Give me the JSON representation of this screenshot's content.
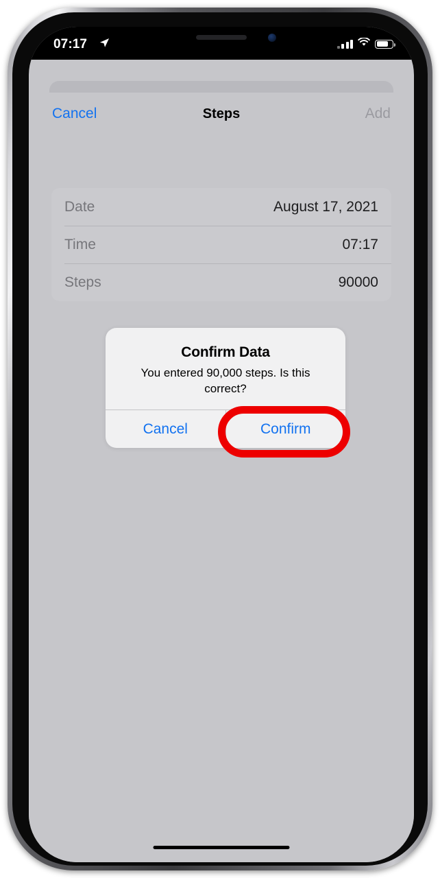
{
  "status_bar": {
    "time": "07:17",
    "location_icon": "location-arrow-icon",
    "signal_icon": "cellular-signal-icon",
    "wifi_icon": "wifi-icon",
    "battery_icon": "battery-icon",
    "signal_bars": 4,
    "battery_level_percent": 67
  },
  "nav_bar": {
    "cancel_label": "Cancel",
    "title": "Steps",
    "add_label": "Add"
  },
  "form": {
    "rows": [
      {
        "label": "Date",
        "value": "August 17, 2021"
      },
      {
        "label": "Time",
        "value": "07:17"
      },
      {
        "label": "Steps",
        "value": "90000"
      }
    ]
  },
  "alert": {
    "title": "Confirm Data",
    "message": "You entered 90,000 steps. Is this correct?",
    "cancel_label": "Cancel",
    "confirm_label": "Confirm"
  },
  "annotation": {
    "shape": "oval",
    "target": "confirm-button",
    "color": "#ed0000"
  },
  "colors": {
    "accent_blue": "#1272f0",
    "disabled_grey": "#9a9aa0",
    "screen_background": "#c6c6ca",
    "card_background": "#cacace",
    "alert_background": "#f1f1f2"
  }
}
